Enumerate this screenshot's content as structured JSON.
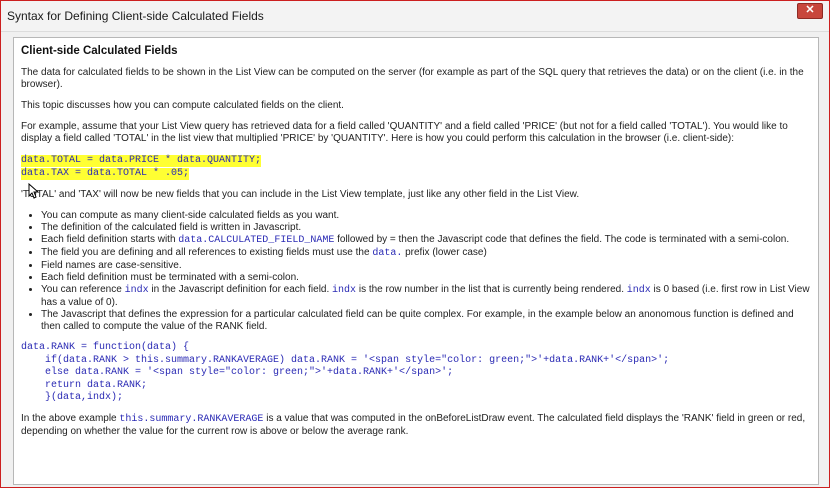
{
  "window": {
    "title": "Syntax for Defining Client-side Calculated Fields",
    "close_label": "✕"
  },
  "doc": {
    "heading": "Client-side Calculated Fields",
    "p1": "The data for calculated fields to be shown in the List View can be computed on the server (for example as part of the SQL query that retrieves the data) or on the client (i.e. in the browser).",
    "p2": "This topic discusses how you can compute calculated fields on the client.",
    "p3": "For example, assume that your List View query has retrieved data for a field called 'QUANTITY' and a field called 'PRICE' (but not for a field called 'TOTAL'). You would like to display a field called 'TOTAL' in the list view that multiplied 'PRICE' by 'QUANTITY'. Here is how you could perform this calculation in the browser (i.e. client-side):",
    "code1": "data.TOTAL = data.PRICE * data.QUANTITY;",
    "code2": "data.TAX = data.TOTAL * .05;",
    "p4": "'TOTAL' and 'TAX' will now be new fields that you can include in the List View template, just like any other field in the List View.",
    "bullets": {
      "b1": "You can compute as many client-side calculated fields as you want.",
      "b2": "The definition of the calculated field is written in Javascript.",
      "b3_pre": "Each field definition starts with ",
      "b3_code": "data.CALCULATED_FIELD_NAME",
      "b3_post": " followed by = then the Javascript code that defines the field. The code is terminated with a semi-colon.",
      "b4_pre": "The field you are defining and all references to existing fields must use the ",
      "b4_code": "data.",
      "b4_post": " prefix (lower case)",
      "b5": "Field names are case-sensitive.",
      "b6": "Each field definition must be terminated with a semi-colon.",
      "b7_pre": "You can reference ",
      "b7_code1": "indx",
      "b7_mid": " in the Javascript definition for each field. ",
      "b7_code2": "indx",
      "b7_mid2": " is the row number in the list that is currently being rendered. ",
      "b7_code3": "indx",
      "b7_post": " is 0 based (i.e. first row in List View has a value of 0).",
      "b8": "The Javascript that defines the expression for a particular calculated field can be quite complex. For example, in the example below an anonomous function is defined and then called to compute the value of the RANK field."
    },
    "fn": {
      "l1": "data.RANK = function(data) {",
      "l2": "    if(data.RANK > this.summary.RANKAVERAGE) data.RANK = '<span style=\"color: green;\">'+data.RANK+'</span>';",
      "l3": "    else data.RANK = '<span style=\"color: green;\">'+data.RANK+'</span>';",
      "l4": "    return data.RANK;",
      "l5": "    }(data,indx);"
    },
    "p5_pre": "In the above example ",
    "p5_code": "this.summary.RANKAVERAGE",
    "p5_post": " is a value that was computed in the onBeforeListDraw event. The calculated field displays the 'RANK' field in green or red, depending on whether the value for the current row is above or below the average rank."
  }
}
